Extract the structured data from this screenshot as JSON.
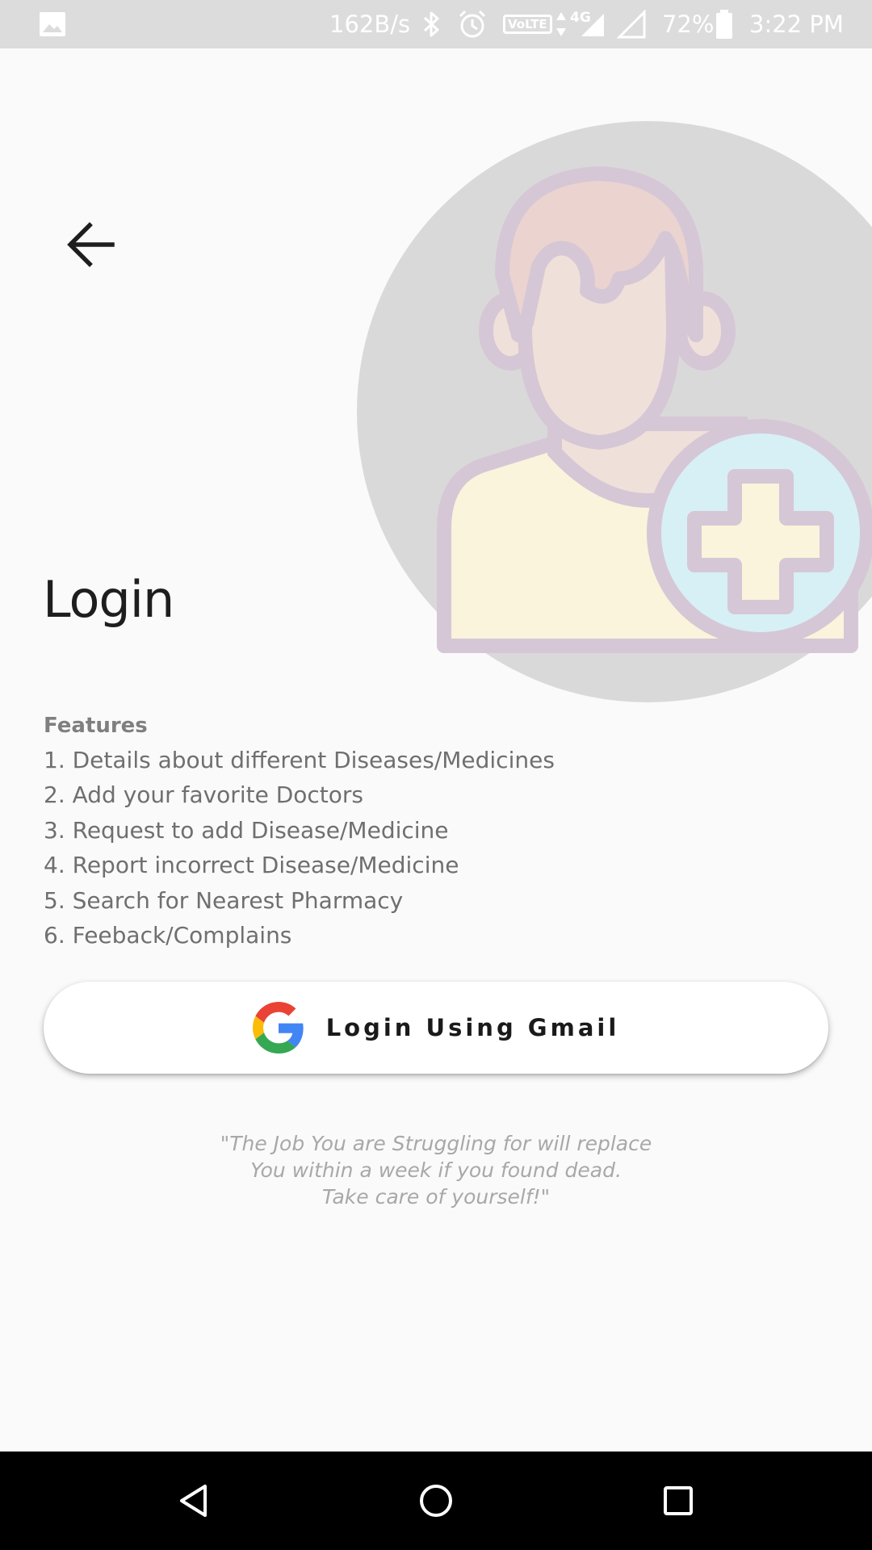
{
  "status_bar": {
    "network_speed": "162B/s",
    "volte": "VoLTE",
    "network_type": "4G",
    "battery": "72%",
    "time": "3:22 PM",
    "icons": [
      "image-icon",
      "bluetooth-icon",
      "alarm-icon",
      "volte-icon",
      "signal-icon",
      "no-signal-icon",
      "battery-icon"
    ]
  },
  "header": {
    "back_icon": "arrow-back-icon",
    "title": "Login",
    "hero_icon": "add-user-icon"
  },
  "features": {
    "heading": "Features",
    "items": [
      "1. Details about different Diseases/Medicines",
      "2. Add your favorite Doctors",
      "3. Request to add Disease/Medicine",
      "4. Report incorrect Disease/Medicine",
      "5. Search for Nearest Pharmacy",
      "6. Feeback/Complains"
    ]
  },
  "login_button": {
    "icon": "google-icon",
    "label": "Login Using Gmail"
  },
  "quote": {
    "lines": [
      "\"The Job You are Struggling for will replace",
      "You within a week if you found dead.",
      "Take care of yourself!\""
    ]
  },
  "nav_bar": {
    "icons": [
      "back-triangle-icon",
      "home-circle-icon",
      "recents-square-icon"
    ]
  },
  "colors": {
    "background": "#fafafa",
    "status_bar": "#dcdcdc",
    "hero_circle": "#d9d9d9",
    "hero_outline": "#d6c7d6",
    "hero_skin": "#f0e0da",
    "hero_shirt": "#f9f4db",
    "hero_badge": "#d7f0f5",
    "google_blue": "#4285F4",
    "google_green": "#34A853",
    "google_yellow": "#FBBC05",
    "google_red": "#EA4335"
  }
}
